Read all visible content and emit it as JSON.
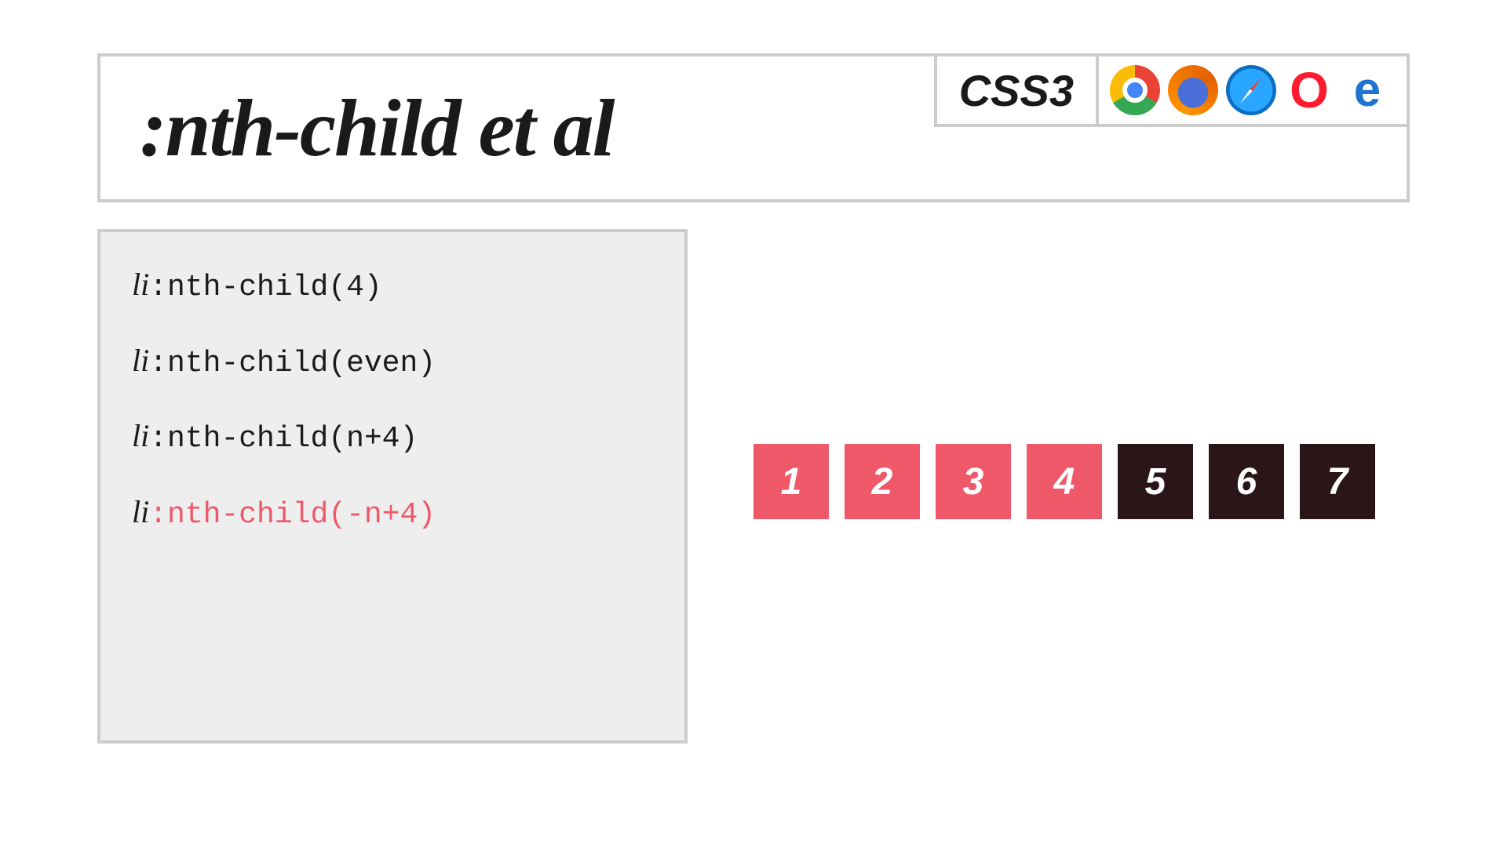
{
  "header": {
    "title": ":nth-child et al",
    "spec_label": "CSS3",
    "browsers": [
      {
        "name": "chrome-icon"
      },
      {
        "name": "firefox-icon"
      },
      {
        "name": "safari-icon"
      },
      {
        "name": "opera-icon",
        "glyph": "O"
      },
      {
        "name": "edge-icon",
        "glyph": "e"
      }
    ]
  },
  "code": {
    "lines": [
      {
        "prefix": "li",
        "rest": ":nth-child(4)",
        "highlight": false
      },
      {
        "prefix": "li",
        "rest": ":nth-child(even)",
        "highlight": false
      },
      {
        "prefix": "li",
        "rest": ":nth-child(n+4)",
        "highlight": false
      },
      {
        "prefix": "li",
        "rest": ":nth-child(-n+4)",
        "highlight": true
      }
    ]
  },
  "boxes": {
    "items": [
      {
        "label": "1",
        "selected": true
      },
      {
        "label": "2",
        "selected": true
      },
      {
        "label": "3",
        "selected": true
      },
      {
        "label": "4",
        "selected": true
      },
      {
        "label": "5",
        "selected": false
      },
      {
        "label": "6",
        "selected": false
      },
      {
        "label": "7",
        "selected": false
      }
    ]
  },
  "colors": {
    "highlight": "#ef5869",
    "box_unselected": "#2a1518",
    "panel_bg": "#eeeeee",
    "border": "#cccccc"
  }
}
